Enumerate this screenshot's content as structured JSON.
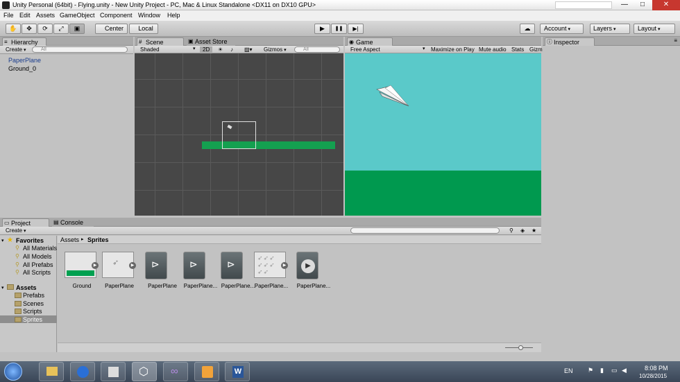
{
  "window": {
    "title": "Unity Personal (64bit) - Flying.unity - New Unity Project - PC, Mac & Linux Standalone <DX11 on DX10 GPU>",
    "controls": {
      "minimize": "—",
      "maximize": "□",
      "close": "✕"
    }
  },
  "menu": [
    "File",
    "Edit",
    "Assets",
    "GameObject",
    "Component",
    "Window",
    "Help"
  ],
  "toolbar": {
    "tools": [
      "hand-icon",
      "move-icon",
      "rotate-icon",
      "scale-icon",
      "rect-icon"
    ],
    "pivot": "Center",
    "space": "Local",
    "play": "▶",
    "pause": "❚❚",
    "step": "▶|",
    "cloud": "☁",
    "account": "Account",
    "layers": "Layers",
    "layout": "Layout"
  },
  "hierarchy": {
    "tab": "Hierarchy",
    "create": "Create",
    "search_placeholder": "All",
    "items": [
      "PaperPlane",
      "Ground_0"
    ]
  },
  "scene": {
    "tabs": [
      "Scene",
      "Asset Store"
    ],
    "shading": "Shaded",
    "mode_2d": "2D",
    "gizmos": "Gizmos",
    "search_placeholder": "All"
  },
  "game": {
    "tab": "Game",
    "aspect": "Free Aspect",
    "maximize": "Maximize on Play",
    "mute": "Mute audio",
    "stats": "Stats",
    "gizmos": "Gizm"
  },
  "inspector": {
    "tab": "Inspector"
  },
  "project": {
    "tabs": [
      "Project",
      "Console"
    ],
    "create": "Create",
    "breadcrumb": [
      "Assets",
      "Sprites"
    ],
    "favorites": {
      "label": "Favorites",
      "items": [
        "All Materials",
        "All Models",
        "All Prefabs",
        "All Scripts"
      ]
    },
    "assets": {
      "label": "Assets",
      "folders": [
        "Prefabs",
        "Scenes",
        "Scripts",
        "Sprites"
      ]
    },
    "asset_items": [
      "Ground",
      "PaperPlane",
      "PaperPlane",
      "PaperPlane...",
      "PaperPlane...",
      "PaperPlane...",
      "PaperPlane..."
    ]
  },
  "taskbar": {
    "language": "EN",
    "time": "8:08 PM",
    "date": "10/28/2015"
  },
  "colors": {
    "sky": "#5ac9c9",
    "ground": "#00994f",
    "scene_bg": "#474747",
    "selection": "#3d6fb6"
  }
}
